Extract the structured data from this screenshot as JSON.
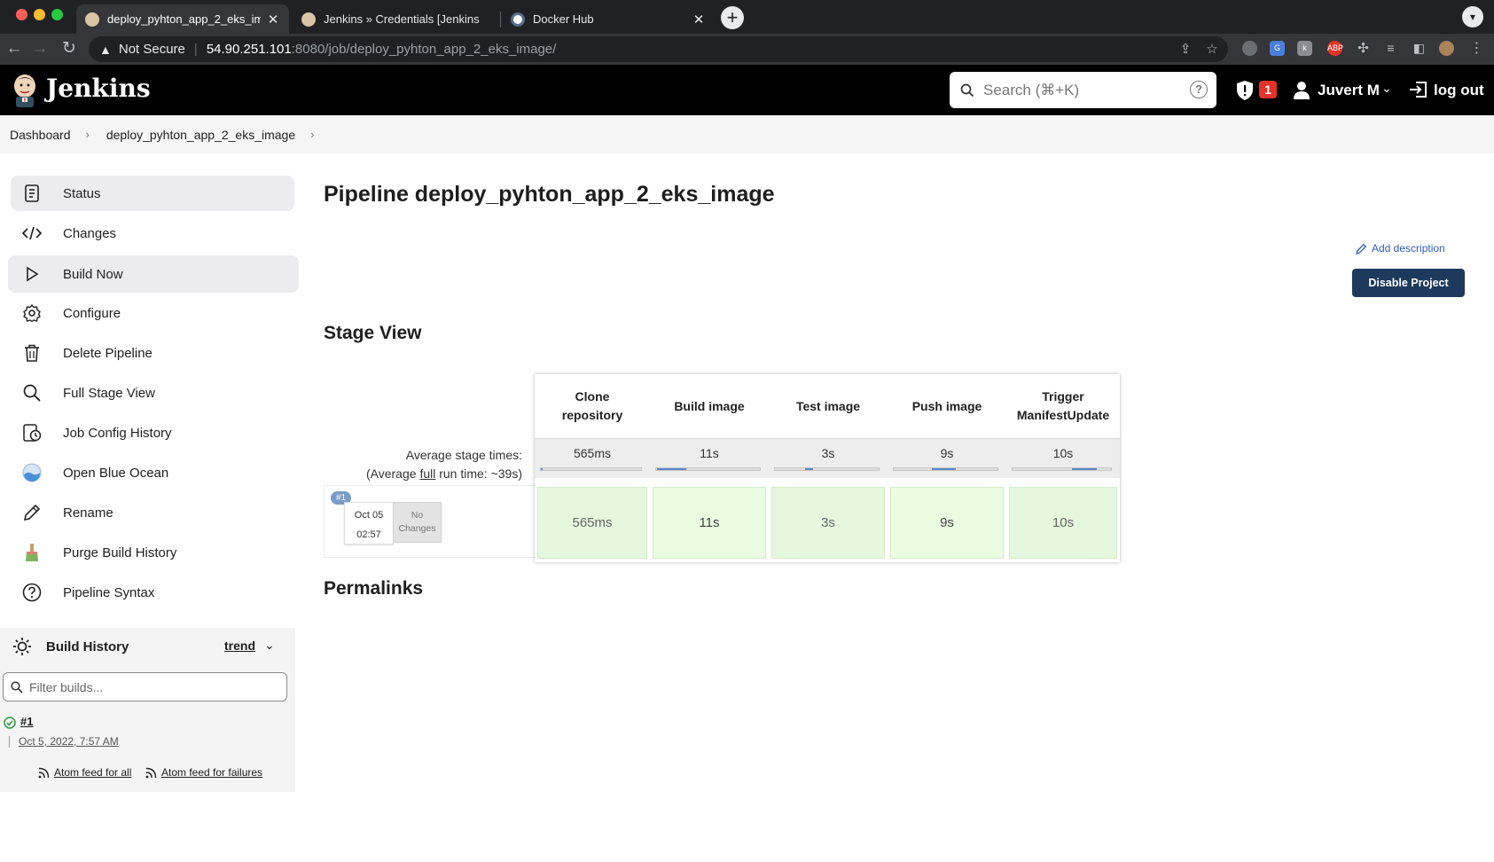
{
  "browser": {
    "tabs": [
      {
        "title": "deploy_pyhton_app_2_eks_im",
        "active": true
      },
      {
        "title": "Jenkins » Credentials [Jenkins",
        "active": false
      },
      {
        "title": "Docker Hub",
        "active": false
      }
    ],
    "close_glyph": "✕",
    "url_warning": "Not Secure",
    "url_host": "54.90.251.101",
    "url_path": ":8080/job/deploy_pyhton_app_2_eks_image/"
  },
  "header": {
    "brand": "Jenkins",
    "search_placeholder": "Search (⌘+K)",
    "help_glyph": "?",
    "alert_count": "1",
    "user": "Juvert M",
    "logout": "log out"
  },
  "breadcrumb": {
    "items": [
      "Dashboard",
      "deploy_pyhton_app_2_eks_image"
    ],
    "separator": "›"
  },
  "sidebar": {
    "items": [
      {
        "label": "Status",
        "icon": "status-icon"
      },
      {
        "label": "Changes",
        "icon": "code-icon"
      },
      {
        "label": "Build Now",
        "icon": "play-icon"
      },
      {
        "label": "Configure",
        "icon": "gear-icon"
      },
      {
        "label": "Delete Pipeline",
        "icon": "trash-icon"
      },
      {
        "label": "Full Stage View",
        "icon": "search-icon"
      },
      {
        "label": "Job Config History",
        "icon": "history-icon"
      },
      {
        "label": "Open Blue Ocean",
        "icon": "blue-ocean-icon"
      },
      {
        "label": "Rename",
        "icon": "pencil-icon"
      },
      {
        "label": "Purge Build History",
        "icon": "broom-icon"
      },
      {
        "label": "Pipeline Syntax",
        "icon": "help-icon"
      }
    ]
  },
  "build_history": {
    "title": "Build History",
    "trend": "trend",
    "filter_placeholder": "Filter builds...",
    "builds": [
      {
        "number": "#1",
        "date": "Oct 5, 2022, 7:57 AM",
        "status": "success"
      }
    ],
    "feeds": [
      "Atom feed for all",
      "Atom feed for failures"
    ]
  },
  "main": {
    "title": "Pipeline deploy_pyhton_app_2_eks_image",
    "add_description": "Add description",
    "disable_button": "Disable Project",
    "stage_view_title": "Stage View",
    "permalinks_title": "Permalinks",
    "average_label": "Average stage times:",
    "average_full_prefix": "(Average ",
    "average_full_word": "full",
    "average_full_suffix": " run time: ~39s)"
  },
  "stages": [
    {
      "name_line1": "Clone",
      "name_line2": "repository",
      "avg": "565ms",
      "run": "565ms",
      "fill_fraction": 0.01
    },
    {
      "name_line1": "Build image",
      "name_line2": "",
      "avg": "11s",
      "run": "11s",
      "fill_fraction": 0.28
    },
    {
      "name_line1": "Test image",
      "name_line2": "",
      "avg": "3s",
      "run": "3s",
      "fill_fraction": 0.08
    },
    {
      "name_line1": "Push image",
      "name_line2": "",
      "avg": "9s",
      "run": "9s",
      "fill_fraction": 0.23
    },
    {
      "name_line1": "Trigger",
      "name_line2": "ManifestUpdate",
      "avg": "10s",
      "run": "10s",
      "fill_fraction": 0.26
    }
  ],
  "run": {
    "badge": "#1",
    "date": "Oct 05",
    "time": "02:57",
    "changes_line1": "No",
    "changes_line2": "Changes"
  },
  "colors": {
    "header_bg": "#000000",
    "accent_button": "#1d3a5c",
    "link": "#2d5db6",
    "stage_success": "#eafde1",
    "progress": "#5b86c7",
    "badge_red": "#e6332a"
  }
}
